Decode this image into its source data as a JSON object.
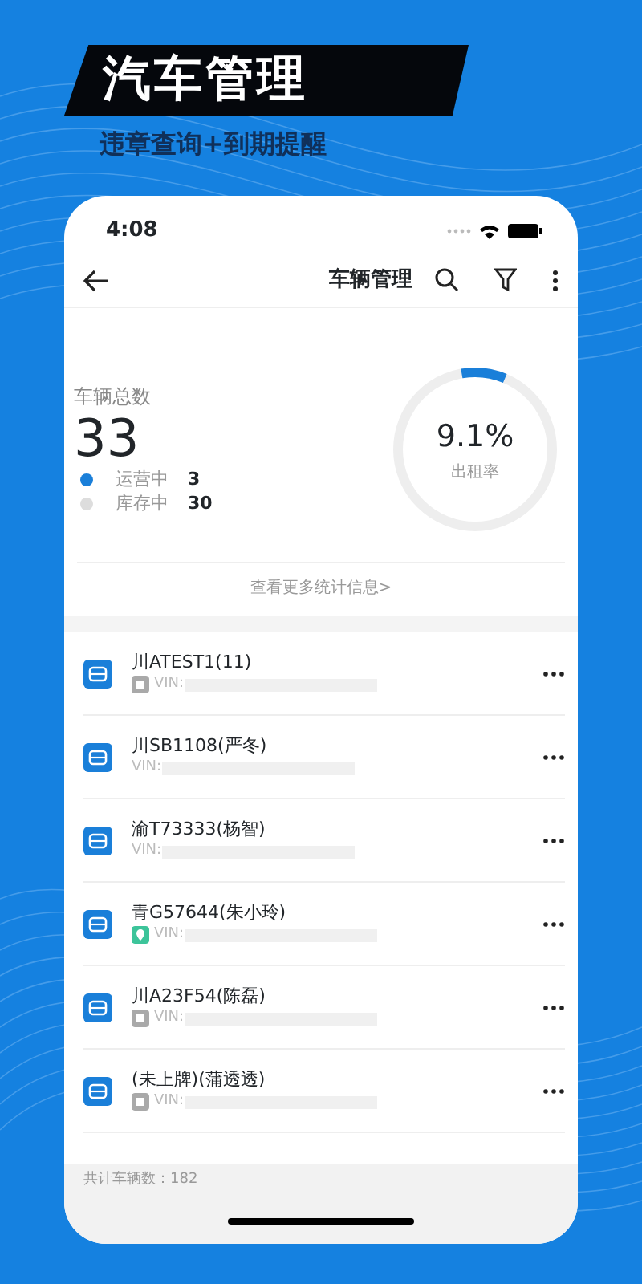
{
  "banner": {
    "title": "汽车管理",
    "subtitle": "违章查询+到期提醒"
  },
  "status_bar": {
    "time": "4:08"
  },
  "header": {
    "title": "车辆管理"
  },
  "stats": {
    "label": "车辆总数",
    "total": "33",
    "legend": [
      {
        "label": "运营中",
        "value": "3",
        "color": "#1a7fd9"
      },
      {
        "label": "库存中",
        "value": "30",
        "color": "#dddddd"
      }
    ],
    "gauge": {
      "value": "9.1%",
      "caption": "出租率",
      "level": 0.091
    },
    "more_link": "查看更多统计信息>"
  },
  "vehicles": [
    {
      "name": "川ATEST1(11)",
      "kind": "grey",
      "vin": "VIN:"
    },
    {
      "name": "川SB1108(严冬)",
      "vin": "VIN:"
    },
    {
      "name": "渝T73333(杨智)",
      "vin": "VIN:"
    },
    {
      "name": "青G57644(朱小玲)",
      "kind": "location",
      "vin": "VIN:"
    },
    {
      "name": "川A23F54(陈磊)",
      "kind": "grey",
      "vin": "VIN:"
    },
    {
      "name": "(未上牌)(蒲透透)",
      "kind": "grey",
      "vin": "VIN:"
    }
  ],
  "footer": {
    "count": "共计车辆数：182"
  }
}
